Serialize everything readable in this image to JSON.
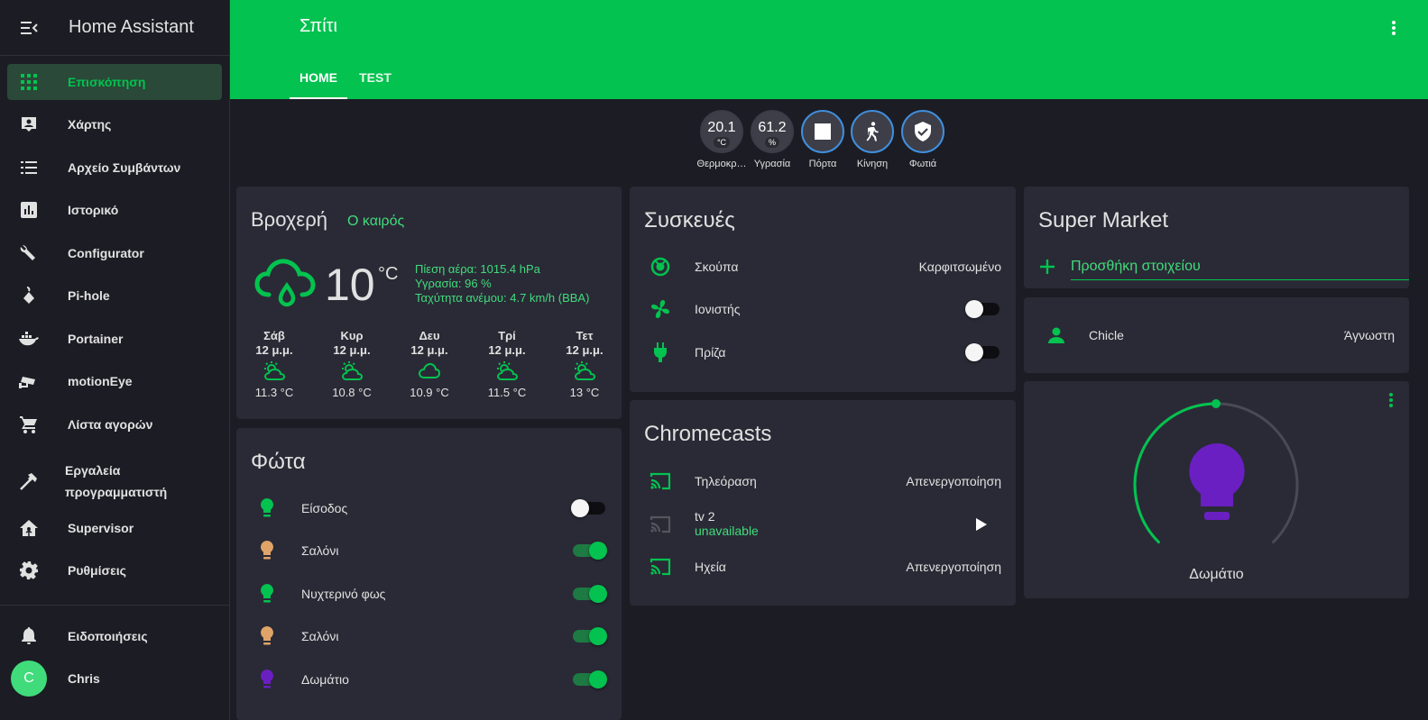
{
  "sidebar": {
    "app_title": "Home Assistant",
    "items": [
      {
        "label": "Επισκόπηση",
        "icon": "grid-icon",
        "active": true
      },
      {
        "label": "Χάρτης",
        "icon": "map-icon"
      },
      {
        "label": "Αρχείο Συμβάντων",
        "icon": "list-icon"
      },
      {
        "label": "Ιστορικό",
        "icon": "chart-bar-icon"
      },
      {
        "label": "Configurator",
        "icon": "wrench-icon"
      },
      {
        "label": "Pi-hole",
        "icon": "pihole-icon"
      },
      {
        "label": "Portainer",
        "icon": "docker-icon"
      },
      {
        "label": "motionEye",
        "icon": "cctv-icon"
      },
      {
        "label": "Λίστα αγορών",
        "icon": "cart-icon"
      },
      {
        "label_line1": "Εργαλεία",
        "label_line2": "προγραμματιστή",
        "icon": "hammer-icon"
      },
      {
        "label": "Supervisor",
        "icon": "home-assistant-icon"
      },
      {
        "label": "Ρυθμίσεις",
        "icon": "gear-icon"
      }
    ],
    "notifications_label": "Ειδοποιήσεις",
    "user_initial": "C",
    "user_name": "Chris"
  },
  "header": {
    "title": "Σπίτι",
    "tabs": [
      "HOME",
      "TEST"
    ],
    "active_tab": "HOME"
  },
  "badges": [
    {
      "value": "20.1",
      "unit": "°C",
      "label": "Θερμοκρ…"
    },
    {
      "value": "61.2",
      "unit": "%",
      "label": "Υγρασία"
    },
    {
      "icon": "square-icon",
      "label": "Πόρτα"
    },
    {
      "icon": "walk-icon",
      "label": "Κίνηση"
    },
    {
      "icon": "shield-check-icon",
      "label": "Φωτιά"
    }
  ],
  "weather": {
    "state": "Βροχερή",
    "name": "Ο καιρός",
    "temperature": "10",
    "unit": "°C",
    "pressure": "Πίεση αέρα: 1015.4 hPa",
    "humidity": "Υγρασία: 96 %",
    "wind": "Ταχύτητα ανέμου: 4.7 km/h (ΒΒΑ)",
    "forecast": [
      {
        "day": "Σάβ",
        "time": "12 μ.μ.",
        "temp": "11.3 °C",
        "icon": "partly-cloudy-icon"
      },
      {
        "day": "Κυρ",
        "time": "12 μ.μ.",
        "temp": "10.8 °C",
        "icon": "partly-cloudy-icon"
      },
      {
        "day": "Δευ",
        "time": "12 μ.μ.",
        "temp": "10.9 °C",
        "icon": "cloudy-icon"
      },
      {
        "day": "Τρί",
        "time": "12 μ.μ.",
        "temp": "11.5 °C",
        "icon": "partly-cloudy-icon"
      },
      {
        "day": "Τετ",
        "time": "12 μ.μ.",
        "temp": "13 °C",
        "icon": "partly-cloudy-icon"
      }
    ]
  },
  "lights": {
    "title": "Φώτα",
    "rows": [
      {
        "name": "Είσοδος",
        "on": false,
        "color": "#03c24f"
      },
      {
        "name": "Σαλόνι",
        "on": true,
        "color": "#e0a468"
      },
      {
        "name": "Νυχτερινό φως",
        "on": true,
        "color": "#03c24f"
      },
      {
        "name": "Σαλόνι",
        "on": true,
        "color": "#e0a468"
      },
      {
        "name": "Δωμάτιο",
        "on": true,
        "color": "#6a1fc2"
      }
    ]
  },
  "devices": {
    "title": "Συσκευές",
    "rows": [
      {
        "name": "Σκούπα",
        "state": "Καρφιτσωμένο",
        "icon": "robot-vacuum-icon"
      },
      {
        "name": "Ιονιστής",
        "on": false,
        "icon": "fan-icon"
      },
      {
        "name": "Πρίζα",
        "on": false,
        "icon": "power-plug-icon"
      }
    ]
  },
  "chromecasts": {
    "title": "Chromecasts",
    "rows": [
      {
        "name": "Τηλεόραση",
        "state": "Απενεργοποίηση",
        "icon": "cast-icon"
      },
      {
        "name": "tv 2",
        "secondary": "unavailable",
        "icon": "cast-icon"
      },
      {
        "name": "Ηχεία",
        "state": "Απενεργοποίηση",
        "icon": "cast-icon"
      }
    ]
  },
  "shopping": {
    "title": "Super Market",
    "add_placeholder": "Προσθήκη στοιχείου"
  },
  "person": {
    "name": "Chicle",
    "state": "Άγνωστη"
  },
  "light_card": {
    "name": "Δωμάτιο",
    "brightness_fraction": 0.5,
    "color": "#6a1fc2"
  },
  "colors": {
    "accent": "#03c24f",
    "background": "#1c1c24",
    "card": "#2a2a36"
  }
}
